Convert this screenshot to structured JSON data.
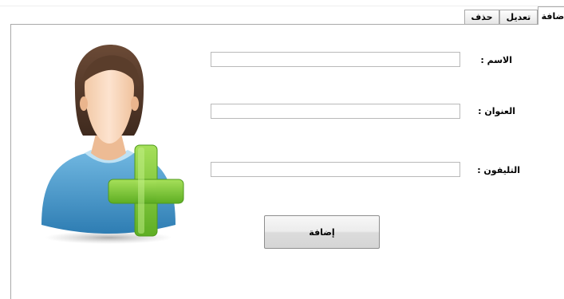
{
  "tabs": [
    {
      "label": "إضافة"
    },
    {
      "label": "تعديل"
    },
    {
      "label": "حذف"
    }
  ],
  "form": {
    "name_label": "الاسم :",
    "address_label": "العنوان :",
    "phone_label": "التليفون :",
    "name_value": "",
    "address_value": "",
    "phone_value": "",
    "submit_label": "إضافة"
  },
  "icons": {
    "avatar": "add-user-icon"
  },
  "colors": {
    "plus_green": "#7ac536",
    "shirt_blue": "#3b8fc4"
  }
}
